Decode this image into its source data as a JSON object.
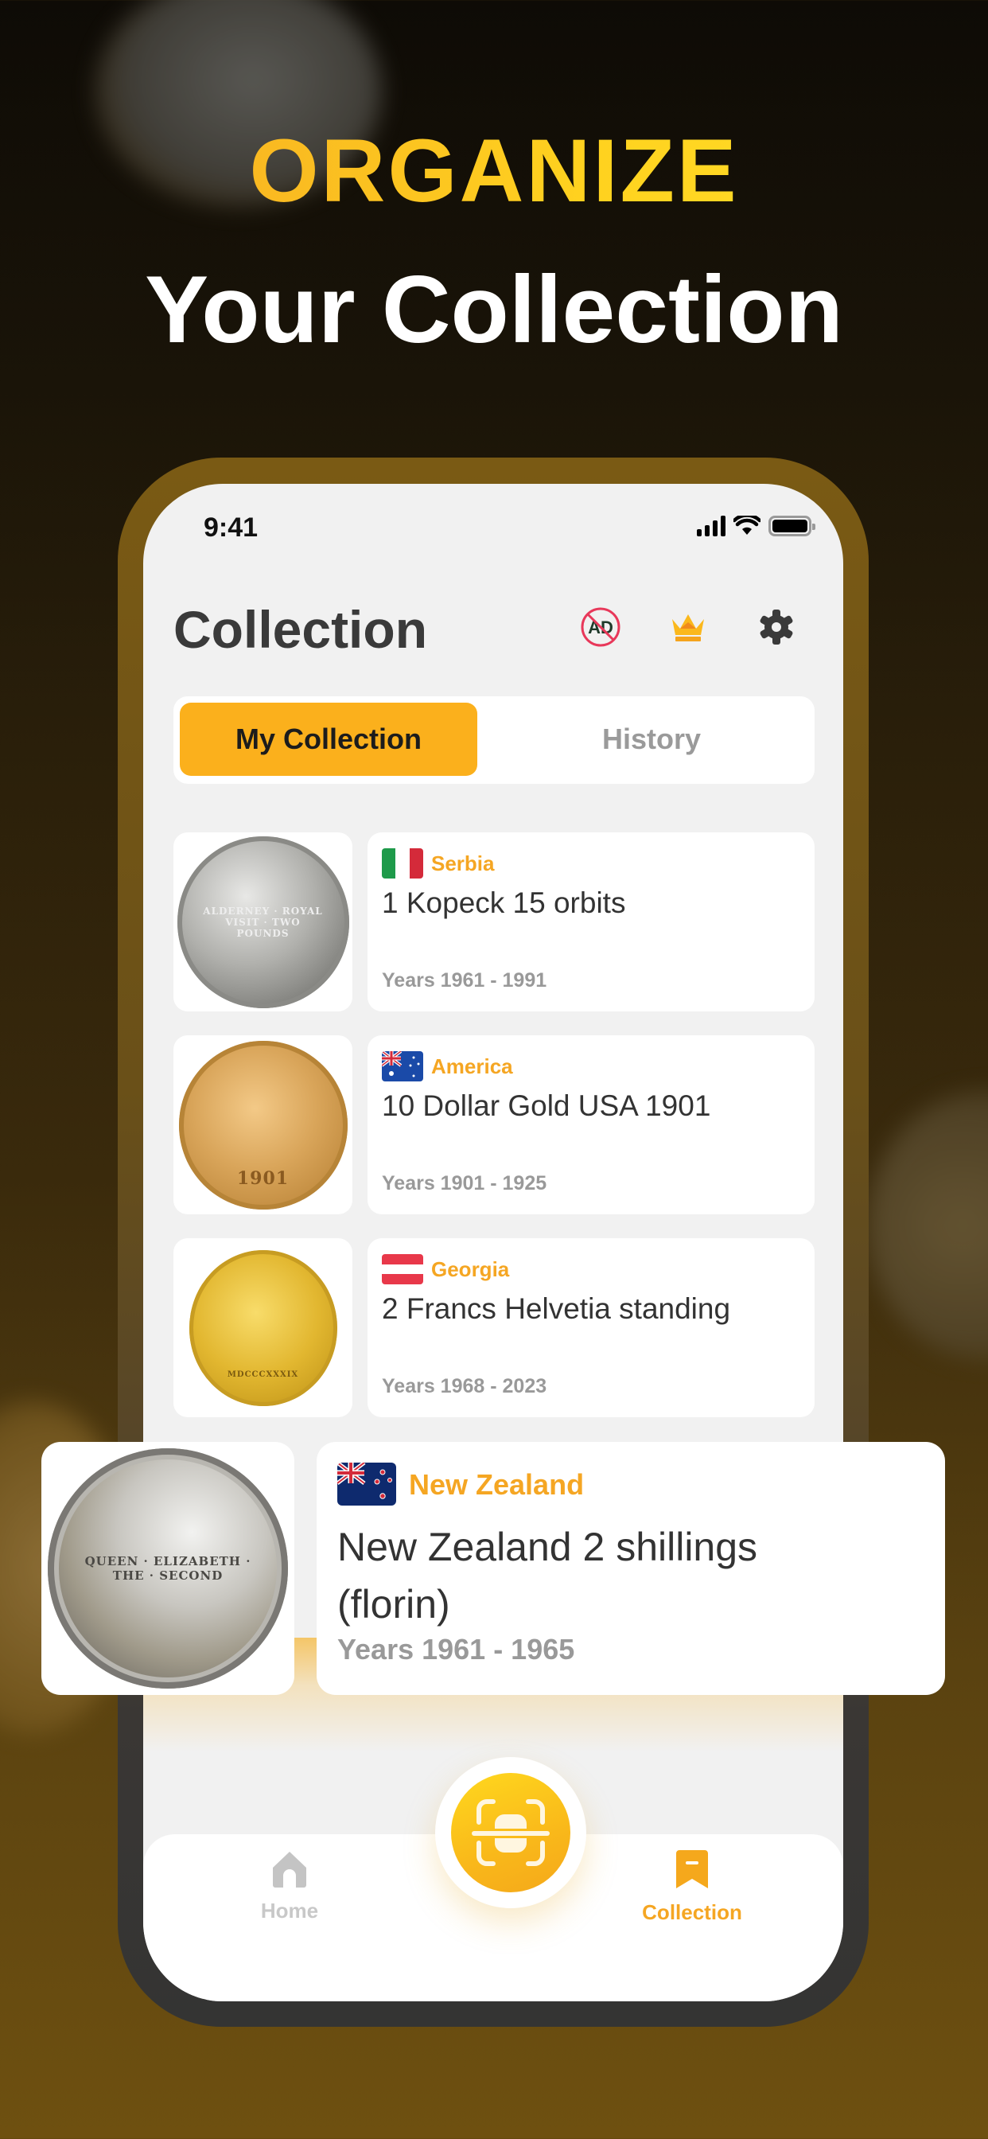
{
  "hero": {
    "line1": "ORGANIZE",
    "line2": "Your Collection"
  },
  "status_bar": {
    "time": "9:41"
  },
  "header": {
    "title": "Collection",
    "icons": [
      "no-ads-icon",
      "crown-icon",
      "gear-icon"
    ]
  },
  "segmented_control": {
    "options": [
      {
        "label": "My Collection",
        "selected": true
      },
      {
        "label": "History",
        "selected": false
      }
    ]
  },
  "collection": [
    {
      "country": "Serbia",
      "flag": "italy-style-flag",
      "name": "1 Kopeck 15 orbits",
      "years": "Years 1961 - 1991",
      "coin_image": "silver-coin-alderney-two-pounds",
      "coin_legend": "ALDERNEY · ROYAL VISIT · TWO POUNDS"
    },
    {
      "country": "America",
      "flag": "australia-style-flag",
      "name": "10 Dollar Gold USA 1901",
      "years": "Years 1901 - 1925",
      "coin_image": "gold-liberty-coin",
      "coin_legend": "1901"
    },
    {
      "country": "Georgia",
      "flag": "austria-style-flag",
      "name": "2 Francs Helvetia standing",
      "years": "Years 1968 - 2023",
      "coin_image": "gold-una-and-lion-coin",
      "coin_legend": "MDCCCXXXIX"
    }
  ],
  "featured": {
    "country": "New Zealand",
    "flag": "new-zealand-flag",
    "name": "New Zealand 2 shillings (florin)",
    "years": "Years 1961 - 1965",
    "coin_image": "queen-elizabeth-silver-coin",
    "coin_legend": "QUEEN · ELIZABETH · THE · SECOND"
  },
  "tabbar": {
    "items": [
      {
        "label": "Home",
        "icon": "home-icon",
        "active": false
      },
      {
        "label": "Collection",
        "icon": "bookmark-icon",
        "active": true
      }
    ],
    "center_button": "scan-icon"
  },
  "colors": {
    "accent": "#fbb01c",
    "country_text": "#f5a623",
    "inactive": "#9a9a9a",
    "title": "#3a3a3a"
  }
}
